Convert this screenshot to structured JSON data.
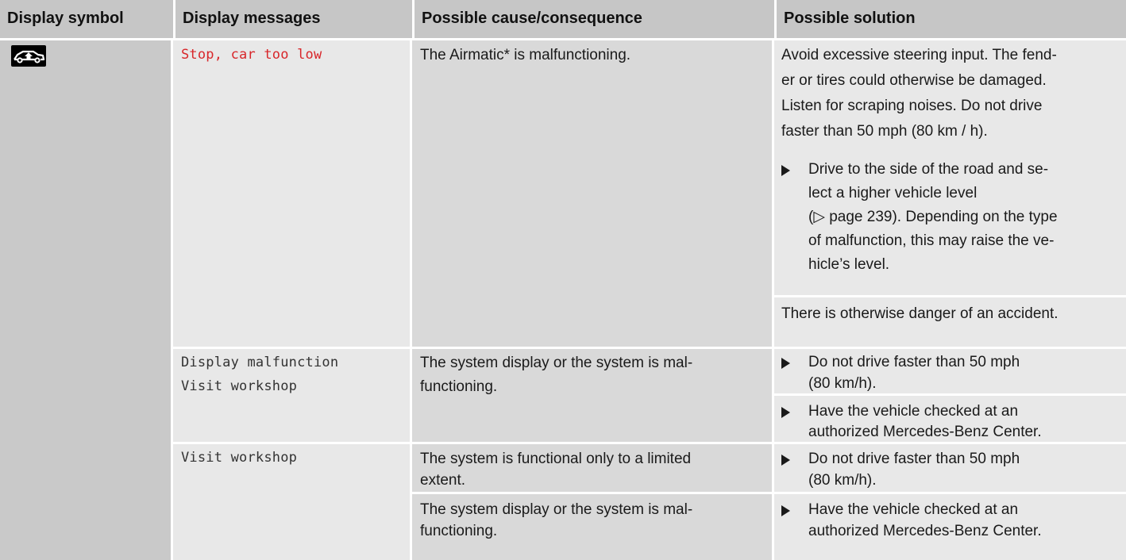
{
  "headers": {
    "symbol": "Display symbol",
    "messages": "Display messages",
    "cause": "Possible cause/consequence",
    "solution": "Possible solution"
  },
  "symbol_icon": "car-level-raise-icon",
  "colors": {
    "header_bg": "#c6c6c6",
    "message_red": "#d8262a",
    "cell_light": "#e8e8e8",
    "cell_dark": "#d9d9d9"
  },
  "rows": [
    {
      "message": "Stop, car too low",
      "cause": "The Airmatic* is malfunctioning.",
      "solution_intro": [
        "Avoid excessive steering input. The fend-",
        "er or tires could otherwise be damaged.",
        "Listen for scraping noises. Do not drive",
        "faster than 50 mph (80 km / h)."
      ],
      "solution_bullet": [
        "Drive to the side of the road and se-",
        "lect a higher vehicle level",
        "(▷ page 239). Depending on the type",
        "of malfunction, this may raise the ve-",
        "hicle’s level."
      ],
      "solution_outro": "There is otherwise danger of an accident."
    },
    {
      "message_lines": [
        "Display malfunction",
        "Visit workshop"
      ],
      "cause_lines": [
        "The system display or the system is mal-",
        "functioning."
      ],
      "bullet1": [
        "Do not drive faster than 50 mph",
        "(80 km/h)."
      ],
      "bullet2": [
        "Have the vehicle checked at an",
        "authorized Mercedes-Benz Center."
      ]
    },
    {
      "message": "Visit workshop",
      "cause1_lines": [
        "The system is functional only to a limited",
        "extent."
      ],
      "cause2_lines": [
        "The system display or the system is mal-",
        "functioning."
      ],
      "bullet1": [
        "Do not drive faster than 50 mph",
        "(80 km/h)."
      ],
      "bullet2": [
        "Have the vehicle checked at an",
        "authorized Mercedes-Benz Center."
      ]
    }
  ]
}
